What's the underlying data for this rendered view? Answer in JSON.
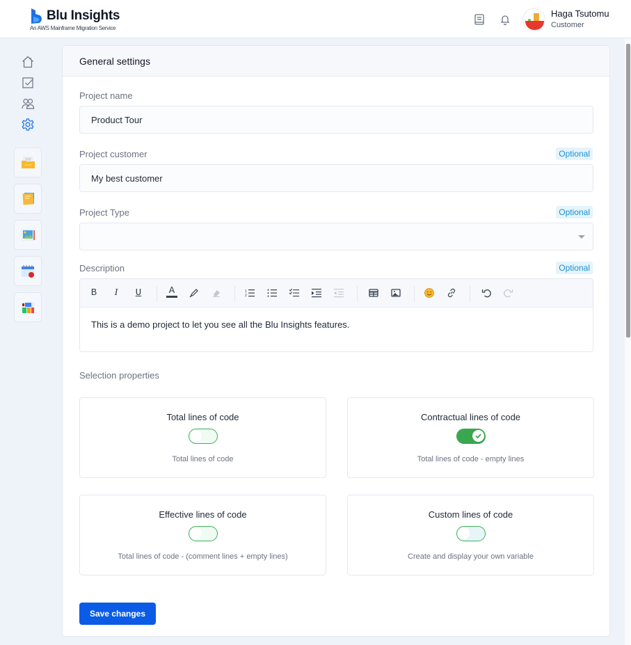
{
  "app": {
    "name": "Blu Insights",
    "tagline": "An AWS Mainframe Migration Service",
    "brand_color": "#1a73e8"
  },
  "header": {
    "icons": [
      "book-icon",
      "bell-icon"
    ],
    "user": {
      "name": "Haga Tsutomu",
      "role": "Customer"
    }
  },
  "sidebar": {
    "nav": [
      {
        "name": "home",
        "icon": "home-icon",
        "active": false
      },
      {
        "name": "tasks",
        "icon": "checkbox-icon",
        "active": false
      },
      {
        "name": "users",
        "icon": "users-icon",
        "active": false
      },
      {
        "name": "settings",
        "icon": "gear-icon",
        "active": true
      }
    ],
    "tiles": [
      {
        "name": "folder",
        "icon": "folder-icon"
      },
      {
        "name": "notes",
        "icon": "notes-icon"
      },
      {
        "name": "gallery",
        "icon": "image-icon"
      },
      {
        "name": "calendar",
        "icon": "calendar-icon"
      },
      {
        "name": "dashboard",
        "icon": "dashboard-icon"
      }
    ]
  },
  "settings": {
    "title": "General settings",
    "optional_label": "Optional",
    "fields": {
      "project_name": {
        "label": "Project name",
        "value": "Product Tour"
      },
      "project_customer": {
        "label": "Project customer",
        "value": "My best customer",
        "optional": true
      },
      "project_type": {
        "label": "Project Type",
        "value": "",
        "optional": true
      },
      "description": {
        "label": "Description",
        "optional": true,
        "value": "This is a demo project to let you see all the Blu Insights features.",
        "toolbar": {
          "bold": "B",
          "italic": "I",
          "underline": "U",
          "font_color": "A"
        }
      }
    },
    "selection": {
      "label": "Selection properties",
      "properties": [
        {
          "title": "Total lines of code",
          "description": "Total lines of code",
          "enabled": false
        },
        {
          "title": "Contractual lines of code",
          "description": "Total lines of code - empty lines",
          "enabled": true
        },
        {
          "title": "Effective lines of code",
          "description": "Total lines of code - (comment lines + empty lines)",
          "enabled": false
        },
        {
          "title": "Custom lines of code",
          "description": "Create and display your own variable",
          "enabled": false
        }
      ]
    },
    "save_label": "Save changes",
    "toggle_color": "#3aa64f",
    "save_color": "#0a5ce6"
  }
}
